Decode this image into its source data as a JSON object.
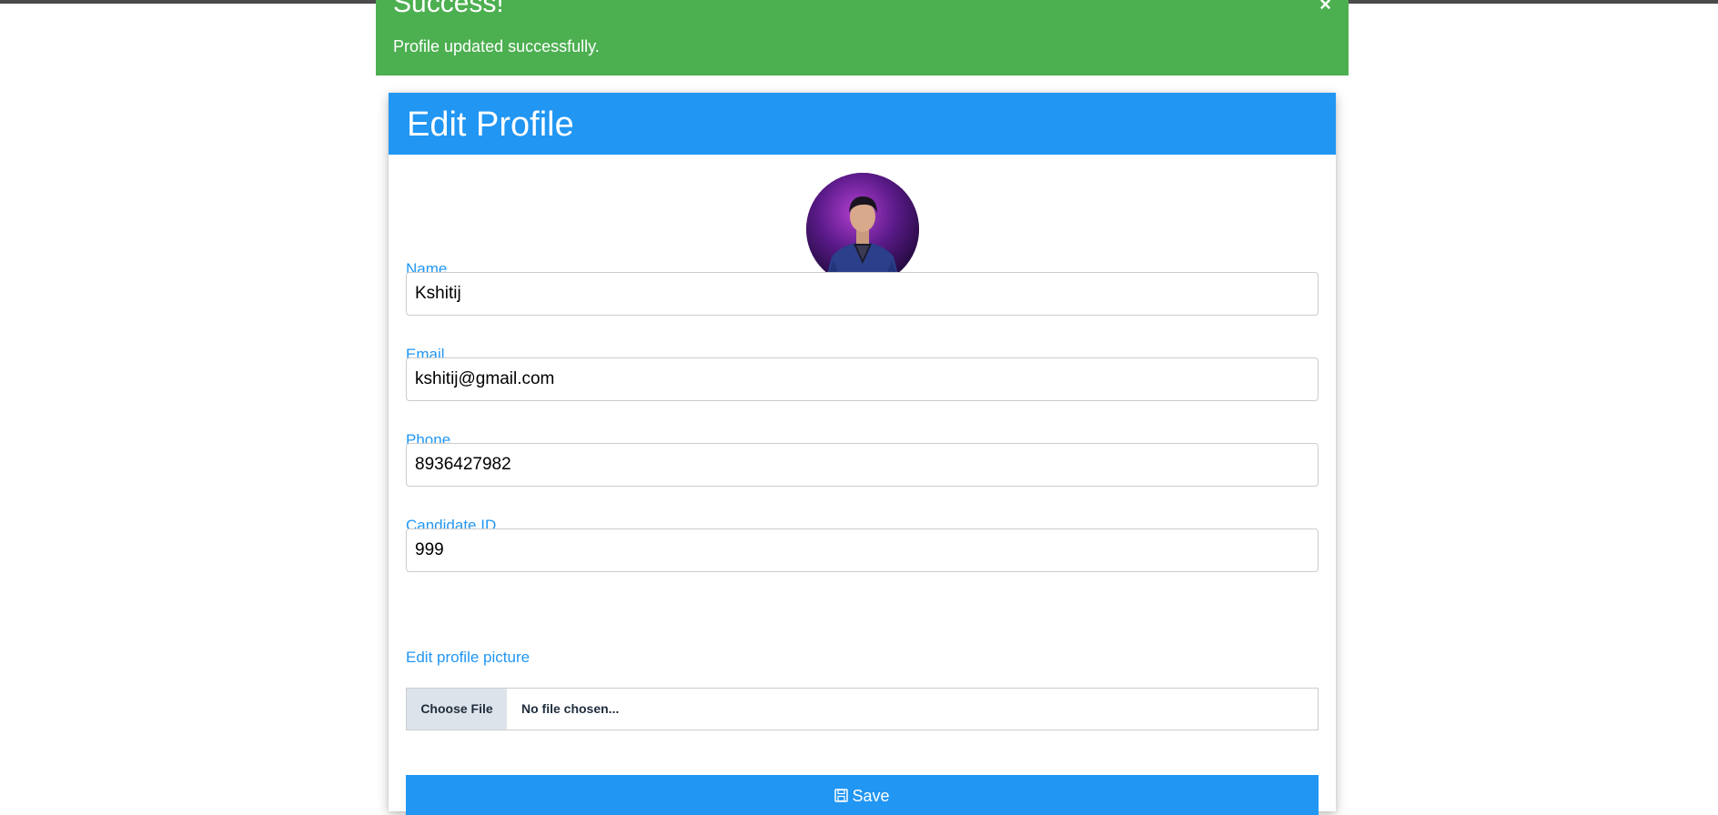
{
  "alert": {
    "title": "Success!",
    "close_glyph": "×",
    "message": "Profile updated successfully.",
    "color": "#4caf50"
  },
  "card": {
    "title": "Edit Profile",
    "accent_color": "#2196f3"
  },
  "form": {
    "name": {
      "label": "Name",
      "value": "Kshitij"
    },
    "email": {
      "label": "Email",
      "value": "kshitij@gmail.com"
    },
    "phone": {
      "label": "Phone",
      "value": "8936427982"
    },
    "candidate_id": {
      "label": "Candidate ID",
      "value": "999"
    },
    "picture": {
      "label": "Edit profile picture",
      "button_label": "Choose File",
      "status": "No file chosen..."
    },
    "save": {
      "label": "Save",
      "icon": "floppy-disk-icon"
    }
  }
}
